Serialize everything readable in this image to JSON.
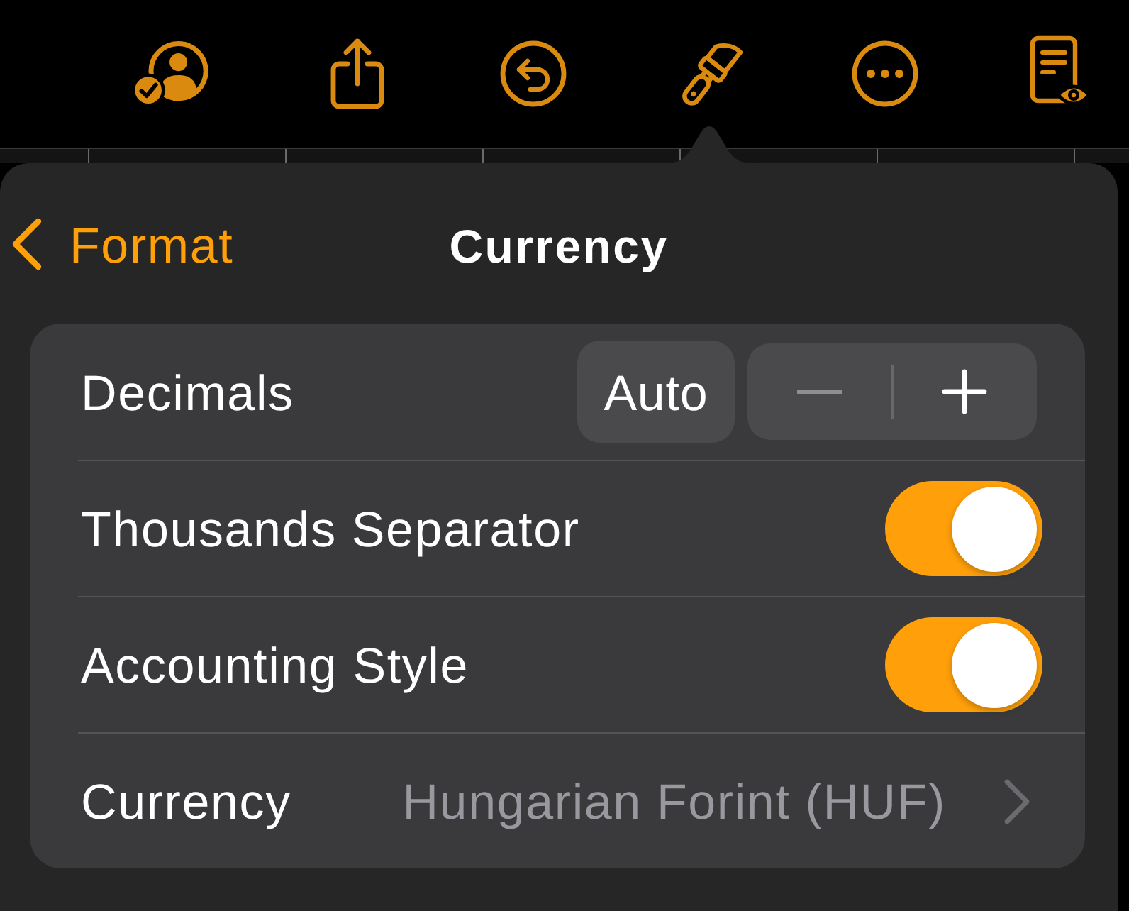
{
  "toolbar": [
    {
      "kind": "collaborate",
      "selected": false
    },
    {
      "kind": "share",
      "selected": false
    },
    {
      "kind": "undo",
      "selected": false
    },
    {
      "kind": "format",
      "selected": true
    },
    {
      "kind": "more",
      "selected": false
    },
    {
      "kind": "reader",
      "selected": false
    }
  ],
  "popover": {
    "back": "Format",
    "title": "Currency"
  },
  "rows": [
    {
      "kind": "stepper",
      "label": "Decimals",
      "value": "Auto",
      "decrement_disabled": true,
      "increment_disabled": false
    },
    {
      "kind": "toggle",
      "label": "Thousands Separator",
      "on": true
    },
    {
      "kind": "toggle",
      "label": "Accounting Style",
      "on": true
    },
    {
      "kind": "disclosure",
      "label": "Currency",
      "value": "Hungarian Forint (HUF)"
    }
  ]
}
